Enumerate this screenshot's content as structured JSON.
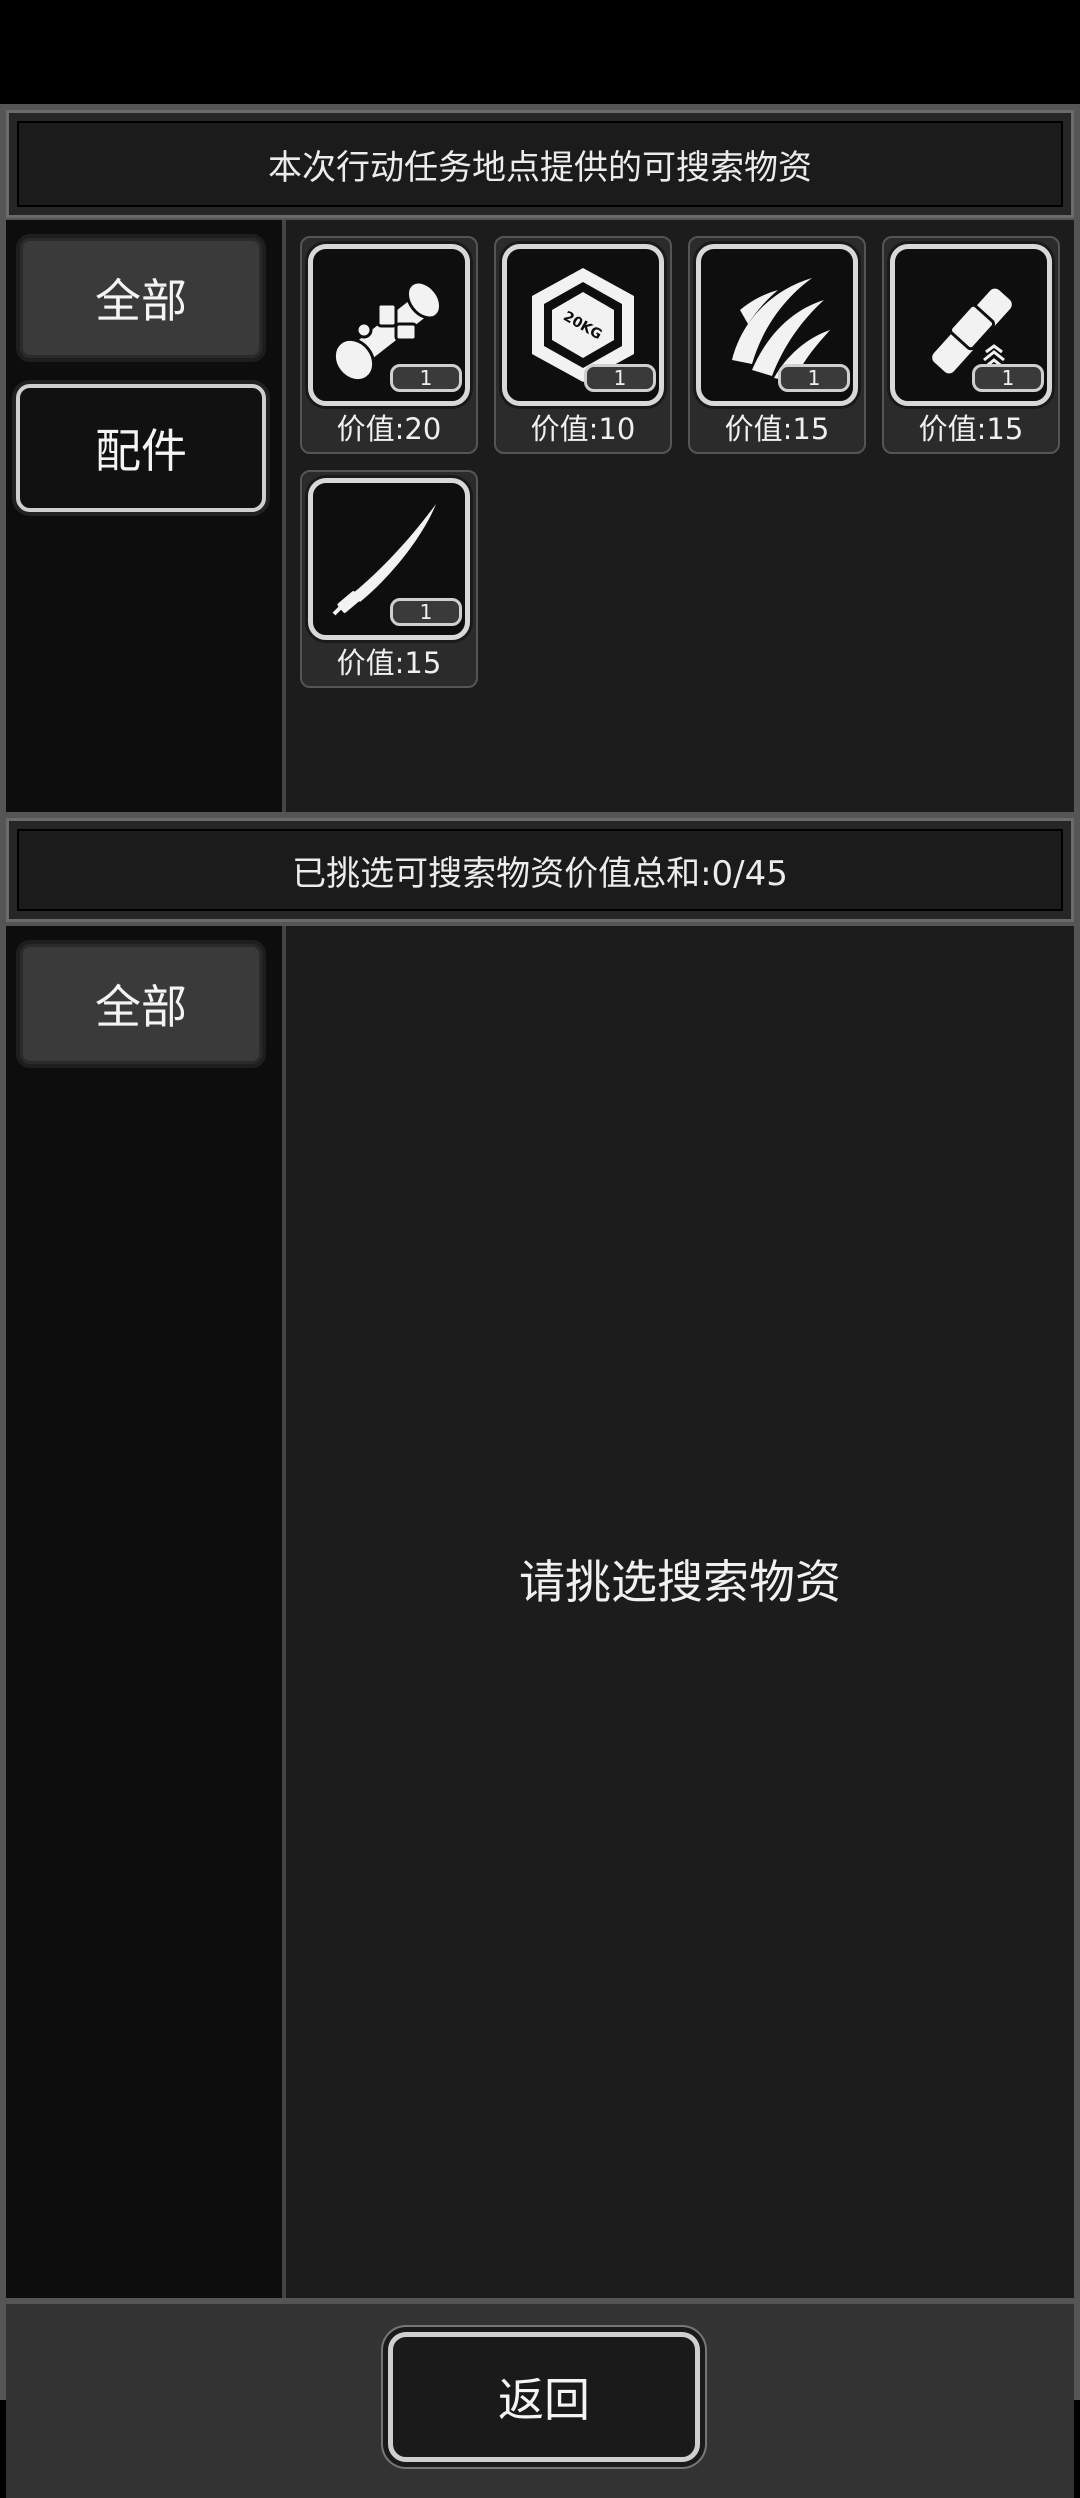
{
  "top_panel": {
    "title": "本次行动任务地点提供的可搜索物资",
    "tabs": [
      {
        "label": "全部"
      },
      {
        "label": "配件"
      }
    ],
    "items": [
      {
        "icon": "scope-icon",
        "qty": "1",
        "value_label": "价值:20"
      },
      {
        "icon": "weight-20kg-icon",
        "qty": "1",
        "value_label": "价值:10"
      },
      {
        "icon": "claw-blades-icon",
        "qty": "1",
        "value_label": "价值:15"
      },
      {
        "icon": "grip-attachment-icon",
        "qty": "1",
        "value_label": "价值:15"
      },
      {
        "icon": "blade-icon",
        "qty": "1",
        "value_label": "价值:15"
      }
    ]
  },
  "bottom_panel": {
    "title": "已挑选可搜索物资价值总和:0/45",
    "tabs": [
      {
        "label": "全部"
      }
    ],
    "empty_message": "请挑选搜索物资"
  },
  "footer": {
    "back_label": "返回"
  }
}
